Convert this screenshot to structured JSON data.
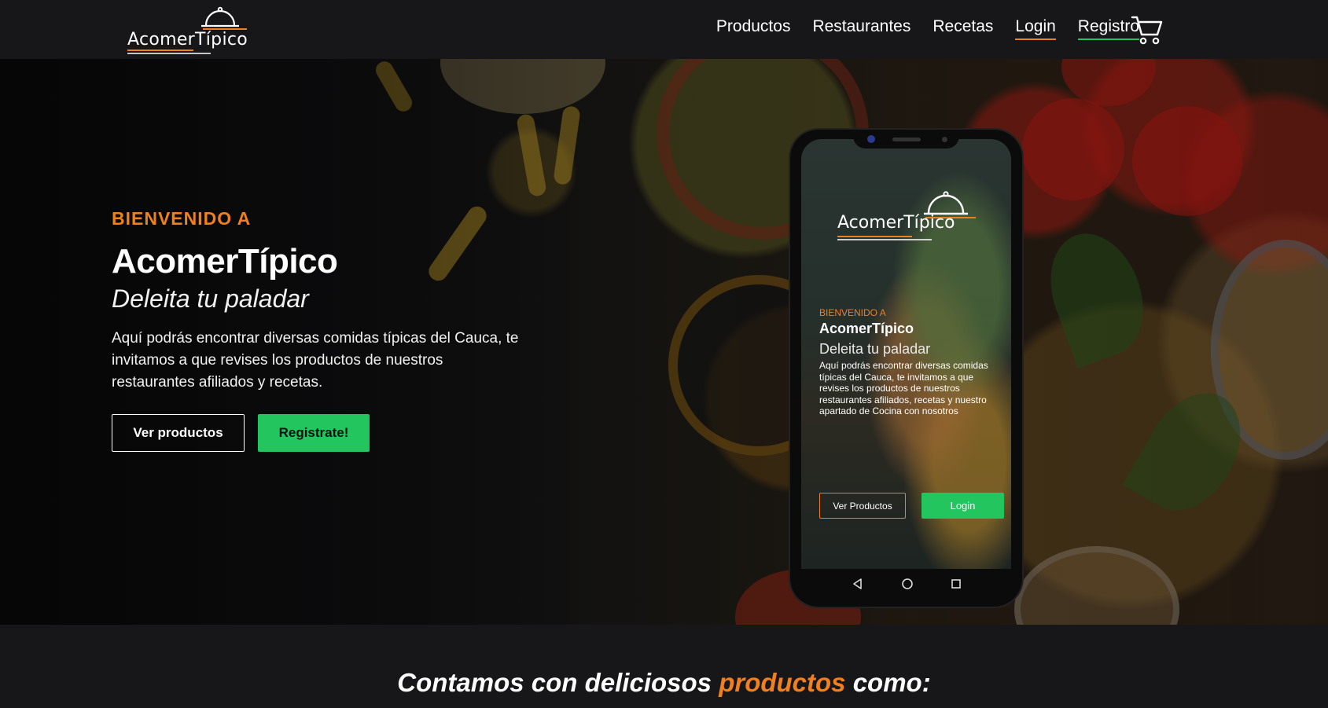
{
  "brand": {
    "logo_text": "AcomerTípico",
    "accent_orange": "#f0801e",
    "accent_green": "#22c55e"
  },
  "nav": {
    "items": [
      {
        "label": "Productos",
        "underline": "none"
      },
      {
        "label": "Restaurantes",
        "underline": "none"
      },
      {
        "label": "Recetas",
        "underline": "none"
      },
      {
        "label": "Login",
        "underline": "orange"
      },
      {
        "label": "Registro",
        "underline": "green"
      }
    ],
    "cart_icon": "cart-icon"
  },
  "hero": {
    "eyebrow": "BIENVENIDO A",
    "title": "AcomerTípico",
    "tagline": "Deleita tu paladar",
    "description": "Aquí podrás encontrar diversas comidas típicas del Cauca, te invitamos a que revises los productos de nuestros restaurantes afiliados y recetas.",
    "primary_button": "Ver productos",
    "secondary_button": "Registrate!"
  },
  "phone": {
    "logo_text": "AcomerTípico",
    "eyebrow": "BIENVENIDO A",
    "title": "AcomerTípico",
    "tagline": "Deleita tu paladar",
    "description": "Aquí podrás encontrar diversas comidas típicas del Cauca, te invitamos a que revises los productos de nuestros restaurantes afiliados, recetas y nuestro apartado de Cocina con nosotros",
    "button_outline": "Ver Productos",
    "button_green": "Login",
    "system_icons": [
      "back-icon",
      "home-icon",
      "recents-icon"
    ]
  },
  "section": {
    "title_before": "Contamos con deliciosos ",
    "title_highlight": "productos",
    "title_after": " como:"
  }
}
